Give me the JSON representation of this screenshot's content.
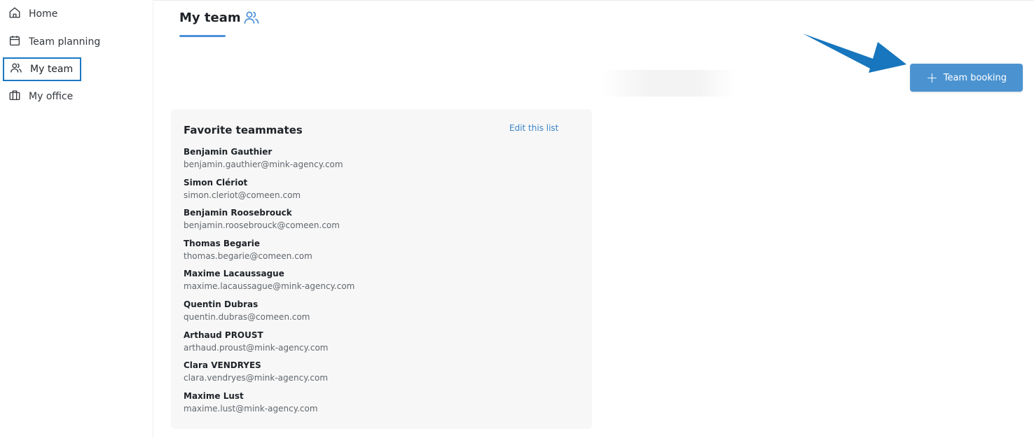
{
  "sidebar": {
    "items": [
      {
        "label": "Home",
        "icon": "home-icon"
      },
      {
        "label": "Team planning",
        "icon": "calendar-icon"
      },
      {
        "label": "My team",
        "icon": "users-icon",
        "active": true
      },
      {
        "label": "My office",
        "icon": "briefcase-icon"
      }
    ]
  },
  "header": {
    "title": "My team",
    "icon": "users-icon"
  },
  "actions": {
    "team_booking_label": "Team booking",
    "team_booking_icon": "plus-icon"
  },
  "favorites": {
    "title": "Favorite teammates",
    "edit_label": "Edit this list",
    "teammates": [
      {
        "name": "Benjamin Gauthier",
        "email": "benjamin.gauthier@mink-agency.com"
      },
      {
        "name": "Simon Clériot",
        "email": "simon.cleriot@comeen.com"
      },
      {
        "name": "Benjamin Roosebrouck",
        "email": "benjamin.roosebrouck@comeen.com"
      },
      {
        "name": "Thomas Begarie",
        "email": "thomas.begarie@comeen.com"
      },
      {
        "name": "Maxime Lacaussague",
        "email": "maxime.lacaussague@mink-agency.com"
      },
      {
        "name": "Quentin Dubras",
        "email": "quentin.dubras@comeen.com"
      },
      {
        "name": "Arthaud PROUST",
        "email": "arthaud.proust@mink-agency.com"
      },
      {
        "name": "Clara VENDRYES",
        "email": "clara.vendryes@mink-agency.com"
      },
      {
        "name": "Maxime Lust",
        "email": "maxime.lust@mink-agency.com"
      }
    ]
  },
  "colors": {
    "accent": "#4b93d0",
    "active_border": "#1b78c2",
    "arrow": "#1776bd"
  }
}
